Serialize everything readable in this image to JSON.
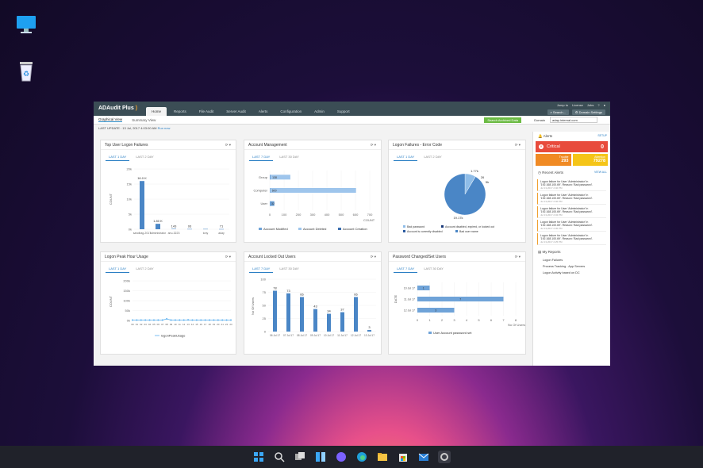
{
  "app": {
    "title": "ADAudit Plus",
    "nav_tabs": [
      "Home",
      "Reports",
      "File Audit",
      "Server Audit",
      "Alerts",
      "Configuration",
      "Admin",
      "Support"
    ],
    "top_links": [
      "Jump to",
      "License",
      "Jobs",
      "?"
    ],
    "search_label": "Search...",
    "domain_settings_label": "Domain Settings",
    "views": [
      "Graphical View",
      "Summary View"
    ],
    "archive_btn": "Search Archived Data",
    "domain_label": "Domain",
    "domain_value": "adap.internal.com",
    "last_update": "LAST UPDATE : 13 Jul, 2017 4:03:00 AM",
    "run_now": "Run now"
  },
  "panels": {
    "top_logon": {
      "title": "Top User Logon Failures",
      "tabs": [
        "LAST 1 DAY",
        "LAST 2 DAY"
      ]
    },
    "account_mgmt": {
      "title": "Account Management",
      "tabs": [
        "LAST 7 DAY",
        "LAST 30 DAY"
      ]
    },
    "logon_error": {
      "title": "Logon Failures - Error Code",
      "tabs": [
        "LAST 1 DAY",
        "LAST 2 DAY"
      ]
    },
    "peak_hour": {
      "title": "Logon Peak Hour Usage",
      "tabs": [
        "LAST 1 DAY",
        "LAST 2 DAY"
      ]
    },
    "locked": {
      "title": "Account Locked Out Users",
      "tabs": [
        "LAST 7 DAY",
        "LAST 30 DAY"
      ]
    },
    "password": {
      "title": "Password Changed/Set Users",
      "tabs": [
        "LAST 7 DAY",
        "LAST 30 DAY"
      ]
    }
  },
  "chart_data": [
    {
      "type": "bar",
      "title": "Top User Logon Failures",
      "ylabel": "COUNT",
      "categories": [
        "sandbag-2017",
        "administrator",
        "anu-3223",
        "",
        "tony",
        "aday"
      ],
      "values": [
        16000,
        1800,
        143,
        93,
        100,
        71
      ],
      "data_labels": [
        "16.0 K",
        "1.80 K",
        "143",
        "93",
        "",
        "71"
      ],
      "yticks": [
        "20k",
        "15k",
        "10k",
        "5k",
        "0k"
      ],
      "ylim": [
        0,
        20000
      ]
    },
    {
      "type": "bar",
      "orientation": "horizontal",
      "title": "Account Management",
      "xlabel": "COUNT",
      "categories": [
        "Group",
        "Computer",
        "User"
      ],
      "series": [
        {
          "name": "Account Modified",
          "values": [
            6,
            4,
            32
          ]
        },
        {
          "name": "Account Deleted",
          "values": [
            138,
            600,
            0
          ]
        },
        {
          "name": "Account Creation",
          "values": [
            0,
            0,
            0
          ]
        }
      ],
      "data_labels": [
        "6",
        "138",
        "4",
        "600",
        "32"
      ],
      "xticks": [
        "0",
        "100",
        "200",
        "300",
        "400",
        "500",
        "600",
        "700"
      ],
      "xlim": [
        0,
        700
      ]
    },
    {
      "type": "pie",
      "title": "Logon Failures - Error Code",
      "slices": [
        {
          "label": "Bad password",
          "value": 1770
        },
        {
          "label": "Account disabled, expired, or locked out",
          "value": 26
        },
        {
          "label": "Account is currently disabled",
          "value": 5
        },
        {
          "label": "Bad user name",
          "value": 19170
        }
      ],
      "data_labels": [
        "1.77k",
        "26",
        "5k",
        "19.17k"
      ],
      "legend": [
        "Bad password",
        "Account disabled, expired, or locked out",
        "Account is currently disabled",
        "Bad user name"
      ]
    },
    {
      "type": "line",
      "title": "Logon Peak Hour Usage",
      "ylabel": "COUNT",
      "x": [
        "00",
        "01",
        "02",
        "03",
        "04",
        "05",
        "06",
        "07",
        "08",
        "09",
        "10",
        "11",
        "12",
        "13",
        "14",
        "15",
        "16",
        "17",
        "18",
        "19",
        "20",
        "21",
        "22",
        "23"
      ],
      "series": [
        {
          "name": "logonPeakUsage",
          "values": [
            2,
            2,
            2,
            2,
            2,
            2,
            2,
            2,
            8,
            2,
            2,
            2,
            2,
            3,
            2,
            2,
            2,
            2,
            2,
            2,
            2,
            2,
            2,
            2
          ]
        }
      ],
      "yticks": [
        "200k",
        "150k",
        "100k",
        "50k",
        "0k"
      ],
      "ylim": [
        0,
        200
      ],
      "legend": [
        "logonPeakUsage"
      ]
    },
    {
      "type": "bar",
      "title": "Account Locked Out Users",
      "ylabel": "No Of Users",
      "categories": [
        "06 Jul 17",
        "07 Jul 17",
        "08 Jul 17",
        "09 Jul 17",
        "10 Jul 17",
        "11 Jul 17",
        "12 Jul 17",
        "13 Jul 17"
      ],
      "values": [
        78,
        73,
        66,
        43,
        34,
        37,
        66,
        3
      ],
      "yticks": [
        "100",
        "75",
        "50",
        "25",
        "0"
      ],
      "ylim": [
        0,
        100
      ]
    },
    {
      "type": "bar",
      "orientation": "horizontal",
      "title": "Password Changed/Set Users",
      "xlabel": "No Of Users",
      "ylabel": "DATE",
      "categories": [
        "10 Jul 17",
        "11 Jul 17",
        "12 Jul 17"
      ],
      "values": [
        1,
        7,
        3
      ],
      "xticks": [
        "0",
        "1",
        "2",
        "3",
        "4",
        "5",
        "6",
        "7",
        "8"
      ],
      "xlim": [
        0,
        8
      ],
      "legend": [
        "User Account password set"
      ]
    }
  ],
  "sidebar": {
    "alerts_title": "Alerts",
    "setup": "SETUP",
    "critical_label": "Critical",
    "critical_count": "0",
    "trouble_label": "Trouble",
    "trouble_count": "293",
    "attention_label": "Attention",
    "attention_count": "79278",
    "recent_title": "Recent Alerts",
    "view_all": "VIEW ALL",
    "alerts": [
      {
        "text": "Logon failure for User 'Administrator' in '192.168.100.69'. Reason: 'Bad password'.",
        "ts": "Jul 13,2017 2:40 PM"
      },
      {
        "text": "Logon failure for User 'Administrator' in '192.168.100.69'. Reason: 'Bad password'.",
        "ts": "Jul 13,2017 2:40 PM"
      },
      {
        "text": "Logon failure for User 'Administrator' in '192.168.100.69'. Reason: 'Bad password'.",
        "ts": "Jul 13,2017 2:32 PM"
      },
      {
        "text": "Logon failure for User 'Administrator' in '192.168.100.69'. Reason: 'Bad password'.",
        "ts": "Jul 13,2017 2:30 PM"
      },
      {
        "text": "Logon failure for User 'Administrator' in '192.168.100.69'. Reason: 'Bad password'.",
        "ts": "Jul 13,2017 2:25 PM"
      }
    ],
    "reports_title": "My Reports",
    "reports": [
      "Logon Failures",
      "Process Tracking - App Servers",
      "Logon Activity based on DC"
    ]
  },
  "colors": {
    "bar": "#4a86c6",
    "accent": "#2a7fc4",
    "critical": "#e84b3c",
    "trouble": "#f08a24",
    "attention": "#f5c518"
  }
}
